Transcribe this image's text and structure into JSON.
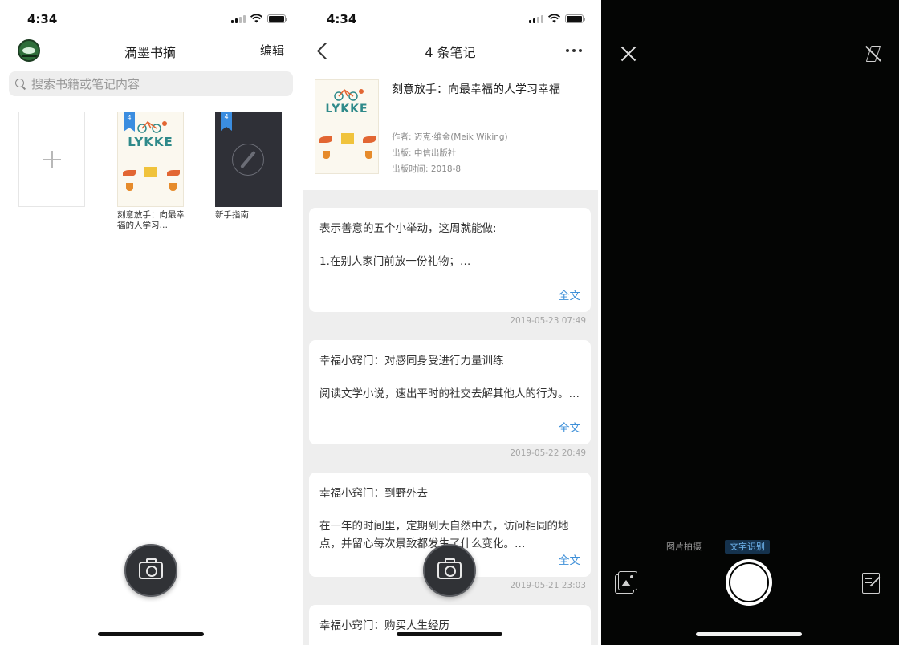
{
  "colors": {
    "accent": "#3d8fd8",
    "bookmark": "#3b8de0",
    "camera_bg": "#040504",
    "active_mode_text": "#6fb4ee"
  },
  "bookshelf": {
    "status_time": "4:34",
    "title": "滴墨书摘",
    "edit_label": "编辑",
    "search_placeholder": "搜索书籍或笔记内容",
    "add_icon": "plus-icon",
    "books": [
      {
        "badge": "4",
        "caption": "刻意放手：向最幸福的人学习…",
        "cover_title": "LYKKE"
      },
      {
        "badge": "4",
        "caption": "新手指南",
        "cover_icon": "compass-icon"
      }
    ],
    "camera_icon": "camera-icon"
  },
  "notes_page": {
    "status_time": "4:34",
    "title": "4 条笔记",
    "book": {
      "title": "刻意放手：向最幸福的人学习幸福",
      "author": "作者: 迈克·维金(Meik Wiking)",
      "publisher": "出版: 中信出版社",
      "pub_date": "出版时间: 2018-8",
      "cover_title": "LYKKE"
    },
    "notes": [
      {
        "title": "表示善意的五个小举动，这周就能做:",
        "body": "1.在别人家门前放一份礼物；…",
        "more": "全文",
        "date": "2019-05-23 07:49"
      },
      {
        "title": "幸福小窍门：对感同身受进行力量训练",
        "body": "阅读文学小说，速出平时的社交去解其他人的行为。…",
        "more": "全文",
        "date": "2019-05-22 20:49"
      },
      {
        "title": "幸福小窍门：到野外去",
        "body": "在一年的时间里，定期到大自然中去，访问相同的地点，并留心每次景致都发生了什么变化。…",
        "more": "全文",
        "date": "2019-05-21 23:03"
      },
      {
        "title": "幸福小窍门：购买人生经历"
      }
    ]
  },
  "camera": {
    "modes": [
      {
        "label": "图片拍摄",
        "active": false
      },
      {
        "label": "文字识别",
        "active": true
      }
    ],
    "close_icon": "close-icon",
    "flash_icon": "flash-off-icon",
    "gallery_icon": "gallery-icon",
    "shutter_icon": "shutter-button",
    "manual_icon": "edit-note-icon"
  }
}
